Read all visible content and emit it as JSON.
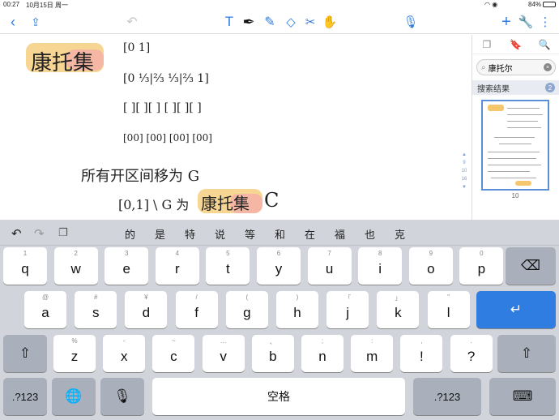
{
  "status": {
    "time": "00:27",
    "date": "10月15日 周一",
    "battery": "84%"
  },
  "toolbar": {
    "back_icon": "chevron-left-icon",
    "tools": [
      "share-icon",
      "undo-icon",
      "text-icon",
      "pen-icon",
      "highlighter-icon",
      "eraser-icon",
      "lasso-icon",
      "hand-icon",
      "mic-icon",
      "add-icon",
      "wrench-icon",
      "more-icon"
    ]
  },
  "note": {
    "title": "康托集",
    "line1": "[0                    1]",
    "line2": "[0      ⅓|⅔     ⅓|⅔     1]",
    "line3": "[ ][  ][ ]     [ ][  ][ ]",
    "line4": "[00]   [00]    [00]   [00]",
    "line5": "所有开区间移为 G",
    "line6": "[0,1] \\ G 为",
    "line6_hl": "康托集",
    "line6_end": "C"
  },
  "sidebar": {
    "search_value": "康托尔",
    "results_label": "搜索结果",
    "results_count": "2",
    "page_number": "10",
    "pager": [
      "9",
      "10",
      "16"
    ]
  },
  "keyboard": {
    "candidates": [
      "的",
      "是",
      "特",
      "说",
      "等",
      "和",
      "在",
      "福",
      "也",
      "克"
    ],
    "row1": [
      {
        "k": "q",
        "s": "1"
      },
      {
        "k": "w",
        "s": "2"
      },
      {
        "k": "e",
        "s": "3"
      },
      {
        "k": "r",
        "s": "4"
      },
      {
        "k": "t",
        "s": "5"
      },
      {
        "k": "y",
        "s": "6"
      },
      {
        "k": "u",
        "s": "7"
      },
      {
        "k": "i",
        "s": "8"
      },
      {
        "k": "o",
        "s": "9"
      },
      {
        "k": "p",
        "s": "0"
      }
    ],
    "row2": [
      {
        "k": "a",
        "s": "@"
      },
      {
        "k": "s",
        "s": "#"
      },
      {
        "k": "d",
        "s": "¥"
      },
      {
        "k": "f",
        "s": "/"
      },
      {
        "k": "g",
        "s": "("
      },
      {
        "k": "h",
        "s": ")"
      },
      {
        "k": "j",
        "s": "「"
      },
      {
        "k": "k",
        "s": "」"
      },
      {
        "k": "l",
        "s": "\""
      }
    ],
    "row3": [
      {
        "k": "z",
        "s": "%"
      },
      {
        "k": "x",
        "s": "-"
      },
      {
        "k": "c",
        "s": "~"
      },
      {
        "k": "v",
        "s": "…"
      },
      {
        "k": "b",
        "s": "、"
      },
      {
        "k": "n",
        "s": ";"
      },
      {
        "k": "m",
        "s": ":"
      },
      {
        "k": "!",
        "s": ","
      },
      {
        "k": "?",
        "s": "."
      }
    ],
    "space": "空格",
    "num_key": ".?123"
  }
}
